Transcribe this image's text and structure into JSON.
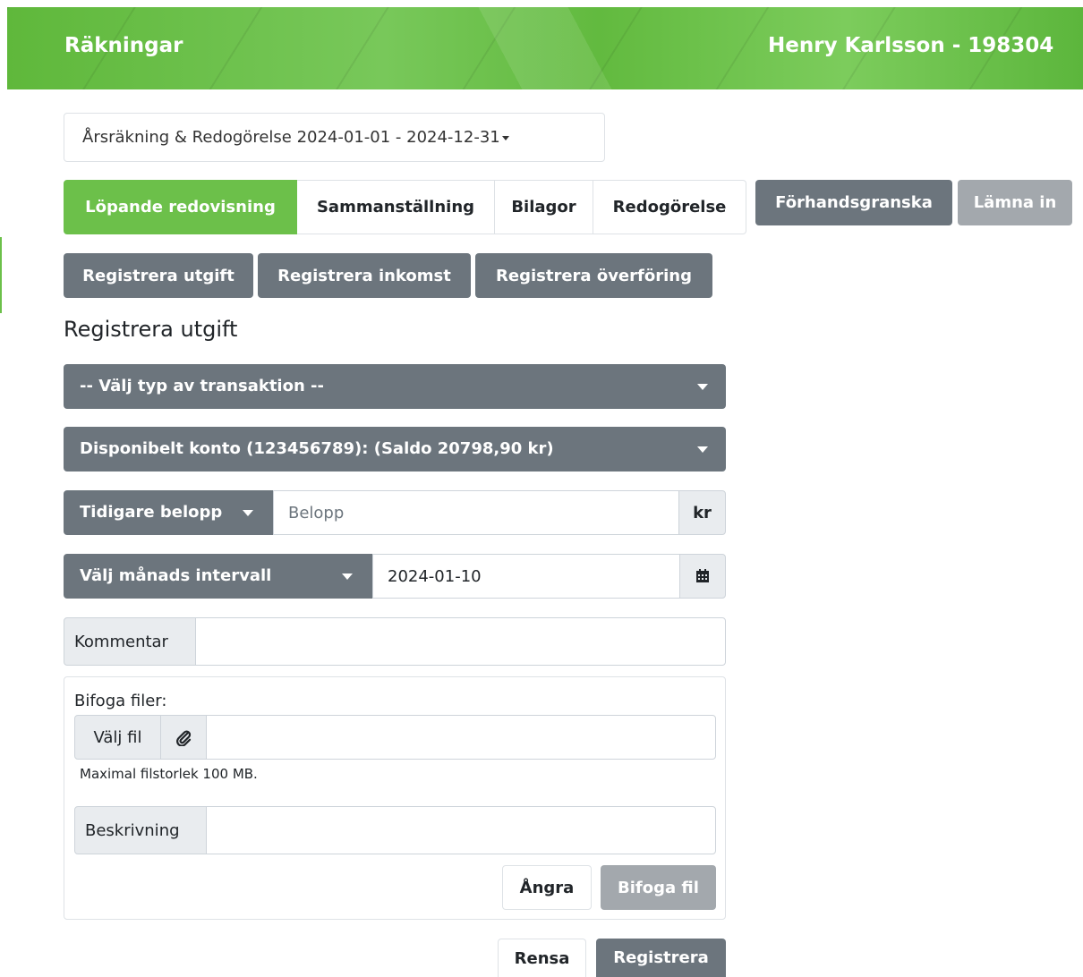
{
  "header": {
    "title": "Räkningar",
    "user": "Henry Karlsson - 198304"
  },
  "period_select": {
    "label": "Årsräkning & Redogörelse 2024-01-01 - 2024-12-31"
  },
  "tabs": [
    {
      "label": "Löpande redovisning",
      "active": true
    },
    {
      "label": "Sammanställning",
      "active": false
    },
    {
      "label": "Bilagor",
      "active": false
    },
    {
      "label": "Redogörelse",
      "active": false
    }
  ],
  "actions": {
    "preview": "Förhandsgranska",
    "submit": "Lämna in"
  },
  "register_buttons": {
    "expense": "Registrera utgift",
    "income": "Registrera inkomst",
    "transfer": "Registrera överföring"
  },
  "form": {
    "title": "Registrera utgift",
    "transaction_type": "-- Välj typ av transaktion --",
    "account": "Disponibelt konto (123456789): (Saldo 20798,90 kr)",
    "amount": {
      "previous_label": "Tidigare belopp",
      "placeholder": "Belopp",
      "unit": "kr"
    },
    "date": {
      "interval_label": "Välj månads intervall",
      "value": "2024-01-10"
    },
    "comment_label": "Kommentar",
    "attach": {
      "label": "Bifoga filer:",
      "choose_file": "Välj fil",
      "max_size": "Maximal filstorlek 100 MB.",
      "description_label": "Beskrivning",
      "undo": "Ångra",
      "attach_file": "Bifoga fil"
    },
    "clear": "Rensa",
    "register": "Registrera"
  },
  "colors": {
    "brand_green": "#6cc04a",
    "gray": "#6c757d",
    "muted_gray": "#a3a8ad"
  }
}
